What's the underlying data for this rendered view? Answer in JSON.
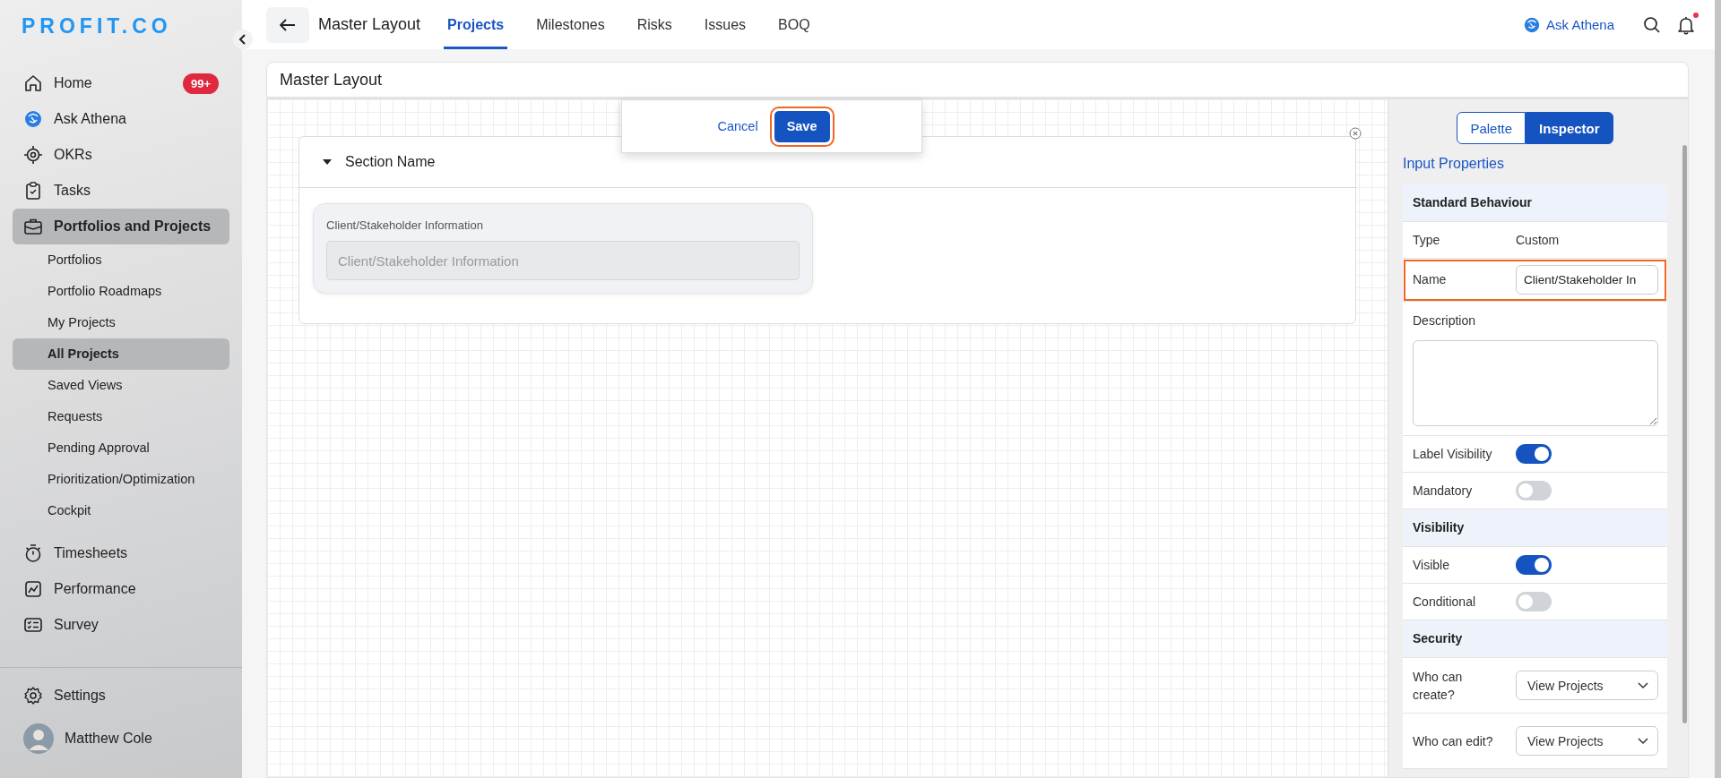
{
  "sidebar": {
    "logo": "PROFIT.CO",
    "nav": [
      {
        "label": "Home",
        "badge": "99+",
        "selected": false
      },
      {
        "label": "Ask Athena",
        "selected": false
      },
      {
        "label": "OKRs",
        "selected": false
      },
      {
        "label": "Tasks",
        "selected": false
      },
      {
        "label": "Portfolios and Projects",
        "selected": true,
        "children": [
          {
            "label": "Portfolios",
            "selected": false
          },
          {
            "label": "Portfolio Roadmaps",
            "selected": false
          },
          {
            "label": "My Projects",
            "selected": false
          },
          {
            "label": "All Projects",
            "selected": true
          },
          {
            "label": "Saved Views",
            "selected": false
          },
          {
            "label": "Requests",
            "selected": false
          },
          {
            "label": "Pending Approval",
            "selected": false
          },
          {
            "label": "Prioritization/Optimization",
            "selected": false
          },
          {
            "label": "Cockpit",
            "selected": false
          }
        ]
      },
      {
        "label": "Timesheets",
        "selected": false
      },
      {
        "label": "Performance",
        "selected": false
      },
      {
        "label": "Survey",
        "selected": false
      }
    ],
    "settings": {
      "label": "Settings"
    },
    "user": {
      "name": "Matthew Cole"
    }
  },
  "topbar": {
    "title": "Master Layout",
    "tabs": [
      {
        "label": "Projects",
        "selected": true
      },
      {
        "label": "Milestones",
        "selected": false
      },
      {
        "label": "Risks",
        "selected": false
      },
      {
        "label": "Issues",
        "selected": false
      },
      {
        "label": "BOQ",
        "selected": false
      }
    ],
    "assistant": {
      "label": "Ask Athena"
    },
    "notifications": {
      "unread": true
    }
  },
  "card": {
    "title": "Master Layout",
    "popover": {
      "cancel": "Cancel",
      "save": "Save",
      "save_highlighted": true
    },
    "section": {
      "title": "Section Name",
      "expanded": true,
      "fields": [
        {
          "label": "Client/Stakeholder Information",
          "placeholder": "Client/Stakeholder Information"
        }
      ]
    }
  },
  "inspector": {
    "switch": [
      {
        "label": "Palette",
        "selected": false
      },
      {
        "label": "Inspector",
        "selected": true
      }
    ],
    "heading": "Input Properties",
    "groups": [
      {
        "title": "Standard Behaviour",
        "rows": [
          {
            "kind": "text",
            "label": "Type",
            "value": "Custom"
          },
          {
            "kind": "input",
            "label": "Name",
            "value": "Client/Stakeholder In",
            "highlighted": true
          },
          {
            "kind": "textarea",
            "label": "Description"
          },
          {
            "kind": "toggle",
            "label": "Label Visibility",
            "on": true
          },
          {
            "kind": "toggle",
            "label": "Mandatory",
            "on": false
          }
        ]
      },
      {
        "title": "Visibility",
        "rows": [
          {
            "kind": "toggle",
            "label": "Visible",
            "on": true
          },
          {
            "kind": "toggle",
            "label": "Conditional",
            "on": false
          }
        ]
      },
      {
        "title": "Security",
        "rows": [
          {
            "kind": "select",
            "label": "Who can create?",
            "value": "View Projects"
          },
          {
            "kind": "select",
            "label": "Who can edit?",
            "value": "View Projects"
          }
        ]
      }
    ]
  }
}
